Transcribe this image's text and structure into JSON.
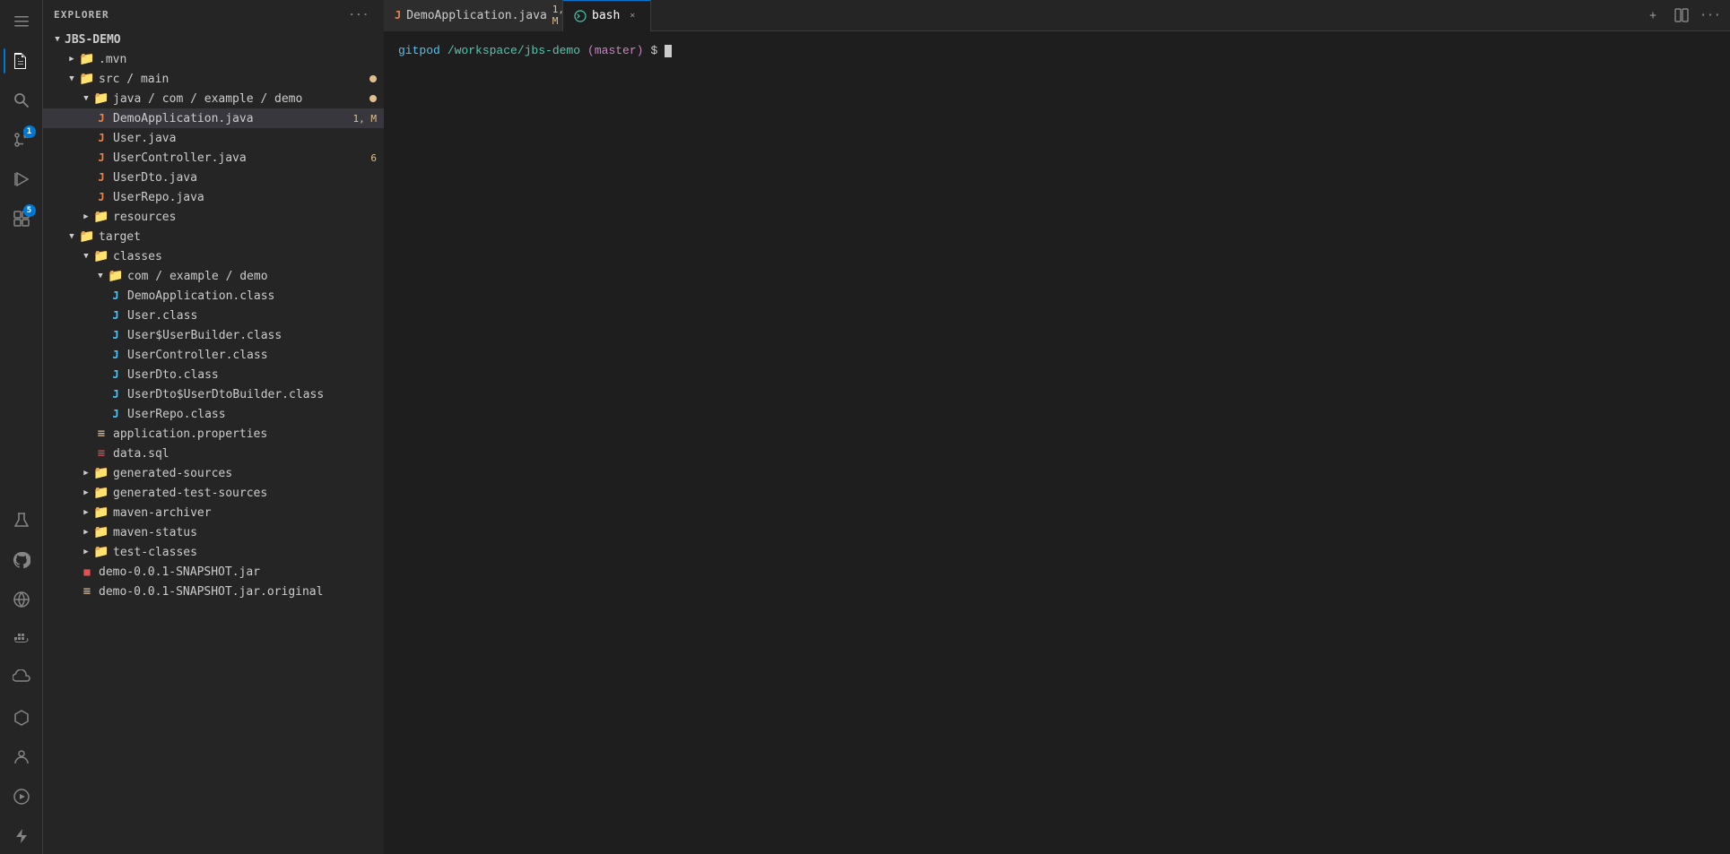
{
  "activityBar": {
    "icons": [
      {
        "name": "menu-icon",
        "symbol": "☰",
        "active": false,
        "badge": null
      },
      {
        "name": "explorer-icon",
        "symbol": "⧉",
        "active": true,
        "badge": null
      },
      {
        "name": "search-icon",
        "symbol": "⌕",
        "active": false,
        "badge": null
      },
      {
        "name": "source-control-icon",
        "symbol": "⎇",
        "active": false,
        "badge": "1"
      },
      {
        "name": "run-icon",
        "symbol": "▷",
        "active": false,
        "badge": null
      },
      {
        "name": "extensions-icon",
        "symbol": "⊞",
        "active": false,
        "badge": "5"
      },
      {
        "name": "flask-icon",
        "symbol": "⚗",
        "active": false,
        "badge": null
      },
      {
        "name": "github-icon",
        "symbol": "⊙",
        "active": false,
        "badge": null
      },
      {
        "name": "remote-icon",
        "symbol": "◈",
        "active": false,
        "badge": null
      },
      {
        "name": "docker-icon",
        "symbol": "◻",
        "active": false,
        "badge": null
      },
      {
        "name": "cloud-icon",
        "symbol": "☁",
        "active": false,
        "badge": null
      },
      {
        "name": "hexagon-icon",
        "symbol": "⬡",
        "active": false,
        "badge": null
      },
      {
        "name": "person-icon",
        "symbol": "⊛",
        "active": false,
        "badge": null
      },
      {
        "name": "play-circle-icon",
        "symbol": "▶",
        "active": false,
        "badge": null
      },
      {
        "name": "zap-icon",
        "symbol": "⚡",
        "active": false,
        "badge": null
      }
    ]
  },
  "sidebar": {
    "header": "EXPLORER",
    "moreLabel": "···",
    "rootFolder": "JBS-DEMO",
    "tree": [
      {
        "id": "mvn",
        "label": ".mvn",
        "type": "folder",
        "indent": 1,
        "expanded": false,
        "badge": null
      },
      {
        "id": "src-main",
        "label": "src / main",
        "type": "folder",
        "indent": 1,
        "expanded": true,
        "badge": "dot-yellow"
      },
      {
        "id": "java-com-example-demo",
        "label": "java / com / example / demo",
        "type": "folder",
        "indent": 2,
        "expanded": true,
        "badge": "dot-yellow"
      },
      {
        "id": "DemoApplication.java",
        "label": "DemoApplication.java",
        "type": "java",
        "indent": 3,
        "selected": true,
        "badge": "1, M"
      },
      {
        "id": "User.java",
        "label": "User.java",
        "type": "java",
        "indent": 3,
        "badge": null
      },
      {
        "id": "UserController.java",
        "label": "UserController.java",
        "type": "java",
        "indent": 3,
        "badge": "6"
      },
      {
        "id": "UserDto.java",
        "label": "UserDto.java",
        "type": "java",
        "indent": 3,
        "badge": null
      },
      {
        "id": "UserRepo.java",
        "label": "UserRepo.java",
        "type": "java",
        "indent": 3,
        "badge": null
      },
      {
        "id": "resources",
        "label": "resources",
        "type": "folder",
        "indent": 2,
        "expanded": false,
        "badge": null
      },
      {
        "id": "target",
        "label": "target",
        "type": "folder",
        "indent": 1,
        "expanded": true,
        "badge": null
      },
      {
        "id": "classes",
        "label": "classes",
        "type": "folder",
        "indent": 2,
        "expanded": true,
        "badge": null
      },
      {
        "id": "com-example-demo",
        "label": "com / example / demo",
        "type": "folder",
        "indent": 3,
        "expanded": true,
        "badge": null
      },
      {
        "id": "DemoApplication.class",
        "label": "DemoApplication.class",
        "type": "class",
        "indent": 4,
        "badge": null
      },
      {
        "id": "User.class",
        "label": "User.class",
        "type": "class",
        "indent": 4,
        "badge": null
      },
      {
        "id": "User$UserBuilder.class",
        "label": "User$UserBuilder.class",
        "type": "class",
        "indent": 4,
        "badge": null
      },
      {
        "id": "UserController.class",
        "label": "UserController.class",
        "type": "class",
        "indent": 4,
        "badge": null
      },
      {
        "id": "UserDto.class",
        "label": "UserDto.class",
        "type": "class",
        "indent": 4,
        "badge": null
      },
      {
        "id": "UserDto$UserDtoBuilder.class",
        "label": "UserDto$UserDtoBuilder.class",
        "type": "class",
        "indent": 4,
        "badge": null
      },
      {
        "id": "UserRepo.class",
        "label": "UserRepo.class",
        "type": "class",
        "indent": 4,
        "badge": null
      },
      {
        "id": "application.properties",
        "label": "application.properties",
        "type": "props",
        "indent": 3,
        "badge": null
      },
      {
        "id": "data.sql",
        "label": "data.sql",
        "type": "sql",
        "indent": 3,
        "badge": null
      },
      {
        "id": "generated-sources",
        "label": "generated-sources",
        "type": "folder",
        "indent": 2,
        "expanded": false,
        "badge": null
      },
      {
        "id": "generated-test-sources",
        "label": "generated-test-sources",
        "type": "folder",
        "indent": 2,
        "expanded": false,
        "badge": null
      },
      {
        "id": "maven-archiver",
        "label": "maven-archiver",
        "type": "folder",
        "indent": 2,
        "expanded": false,
        "badge": null
      },
      {
        "id": "maven-status",
        "label": "maven-status",
        "type": "folder",
        "indent": 2,
        "expanded": false,
        "badge": null
      },
      {
        "id": "test-classes",
        "label": "test-classes",
        "type": "folder",
        "indent": 2,
        "expanded": false,
        "badge": null
      },
      {
        "id": "demo-0.0.1-SNAPSHOT.jar",
        "label": "demo-0.0.1-SNAPSHOT.jar",
        "type": "jar",
        "indent": 2,
        "badge": null
      },
      {
        "id": "demo-0.0.1-SNAPSHOT.jar.original",
        "label": "demo-0.0.1-SNAPSHOT.jar.original",
        "type": "props",
        "indent": 2,
        "badge": null
      }
    ]
  },
  "tabs": [
    {
      "id": "demo-app-tab",
      "label": "DemoApplication.java",
      "icon": "J",
      "iconColor": "#e8834d",
      "active": false,
      "modified": true,
      "modifiedLabel": "1, M"
    },
    {
      "id": "bash-tab",
      "label": "bash",
      "icon": "bash",
      "active": true,
      "closable": true
    }
  ],
  "tabsActions": {
    "addLabel": "+",
    "splitLabel": "⧉",
    "moreLabel": "···"
  },
  "terminal": {
    "prompt": {
      "gitpod": "gitpod",
      "separator": " ",
      "path": "/workspace/jbs-demo",
      "branch": "(master)",
      "dollar": "$"
    }
  }
}
